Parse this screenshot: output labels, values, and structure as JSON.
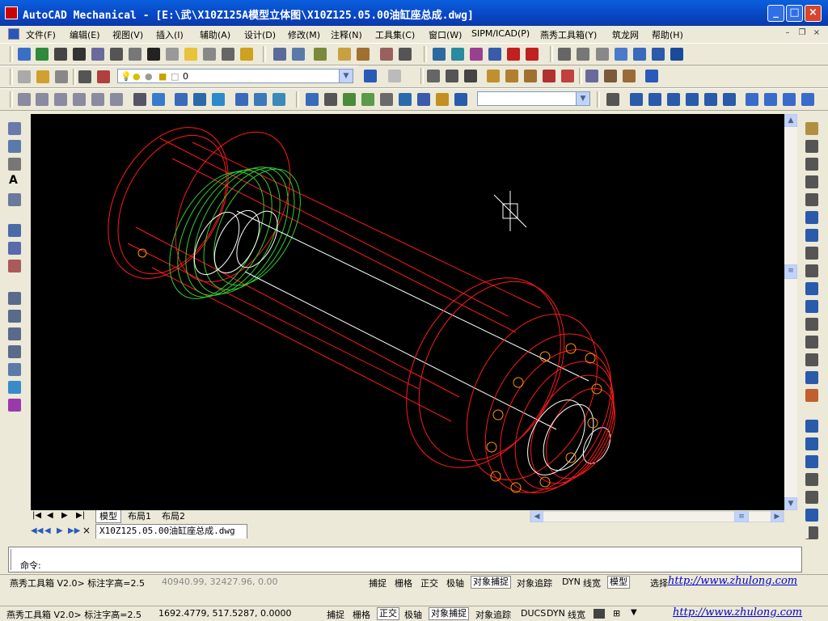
{
  "window": {
    "title": "AutoCAD Mechanical - [E:\\武\\X10Z125A模型立体图\\X10Z125.05.00油缸座总成.dwg]"
  },
  "menu": {
    "items": [
      "文件(F)",
      "编辑(E)",
      "视图(V)",
      "插入(I)",
      "辅助(A)",
      "设计(D)",
      "修改(M)",
      "注释(N)",
      "工具集(C)",
      "窗口(W)",
      "SIPM/ICAD(P)",
      "燕秀工具箱(Y)",
      "筑龙网",
      "帮助(H)"
    ]
  },
  "toolbar": {
    "layer_value": "0"
  },
  "layout_tabs": [
    "模型",
    "布局1",
    "布局2"
  ],
  "document_tab": "X10Z125.05.00油缸座总成.dwg",
  "command": {
    "prompt": "命令:"
  },
  "status1": {
    "plugin": "燕秀工具箱 V2.0> 标注字高=2.5",
    "coords": "40940.99, 32427.96, 0.00",
    "buttons": [
      "捕捉",
      "栅格",
      "正交",
      "极轴",
      "对象捕捉",
      "对象追踪",
      "DYN",
      "线宽",
      "模型"
    ],
    "extra": "选择",
    "link": "http://www.zhulong.com"
  },
  "status2": {
    "plugin": "燕秀工具箱 V2.0> 标注字高=2.5",
    "coords": "1692.4779, 517.5287, 0.0000",
    "buttons": [
      "捕捉",
      "栅格",
      "正交",
      "极轴",
      "对象捕捉",
      "对象追踪",
      "DUCS",
      "DYN",
      "线宽"
    ],
    "link": "http://www.zhulong.com"
  },
  "colors": {
    "titlebar": "#0846c4",
    "canvas": "#000000",
    "wire_red": "#ff1a1a",
    "wire_green": "#33cc33",
    "wire_white": "#ffffff",
    "bolt_orange": "#ff9900",
    "link": "#0000cc"
  }
}
